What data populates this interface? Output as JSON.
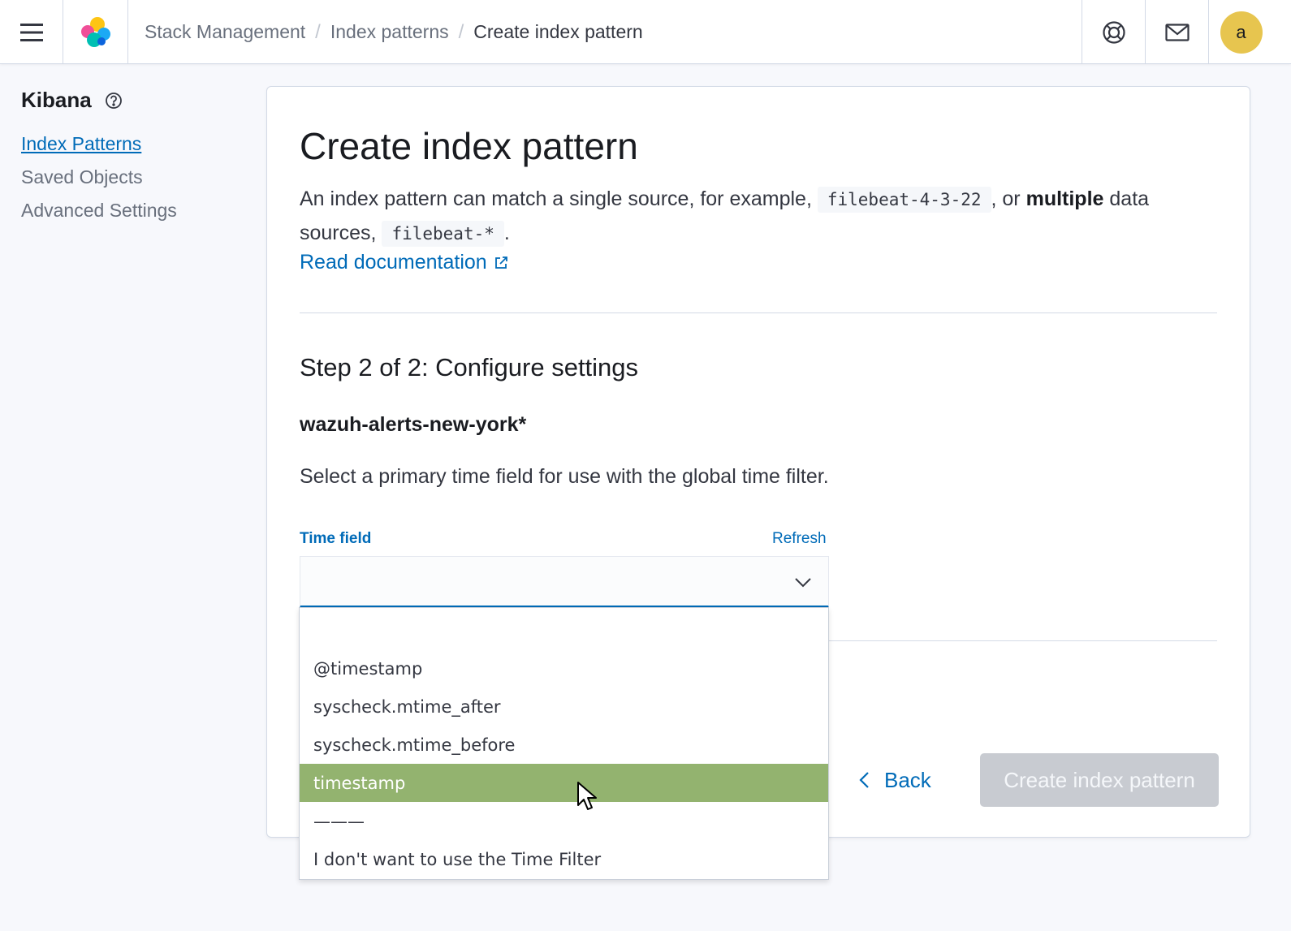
{
  "header": {
    "breadcrumbs": [
      "Stack Management",
      "Index patterns"
    ],
    "current": "Create index pattern",
    "avatar_initial": "a"
  },
  "sidebar": {
    "title": "Kibana",
    "items": [
      {
        "label": "Index Patterns",
        "active": true
      },
      {
        "label": "Saved Objects",
        "active": false
      },
      {
        "label": "Advanced Settings",
        "active": false
      }
    ]
  },
  "main": {
    "title": "Create index pattern",
    "description": {
      "part1": "An index pattern can match a single source, for example,",
      "code1": "filebeat-4-3-22",
      "part2": ", or",
      "bold": "multiple",
      "part3": "data sources,",
      "code2": "filebeat-*",
      "part4": "."
    },
    "doc_link": "Read documentation",
    "step_title": "Step 2 of 2: Configure settings",
    "pattern_name": "wazuh-alerts-new-york*",
    "primary_desc": "Select a primary time field for use with the global time filter.",
    "time_field": {
      "label": "Time field",
      "refresh": "Refresh",
      "value": ""
    },
    "back_label": "Back",
    "create_label": "Create index pattern"
  },
  "dropdown": {
    "options": [
      "",
      "@timestamp",
      "syscheck.mtime_after",
      "syscheck.mtime_before",
      "timestamp",
      "———",
      "I don't want to use the Time Filter"
    ],
    "selected_index": 4
  },
  "colors": {
    "accent": "#006bb8",
    "selected_option": "#93b36f",
    "avatar": "#e7c54f",
    "disabled_button": "#c8cbd1"
  }
}
